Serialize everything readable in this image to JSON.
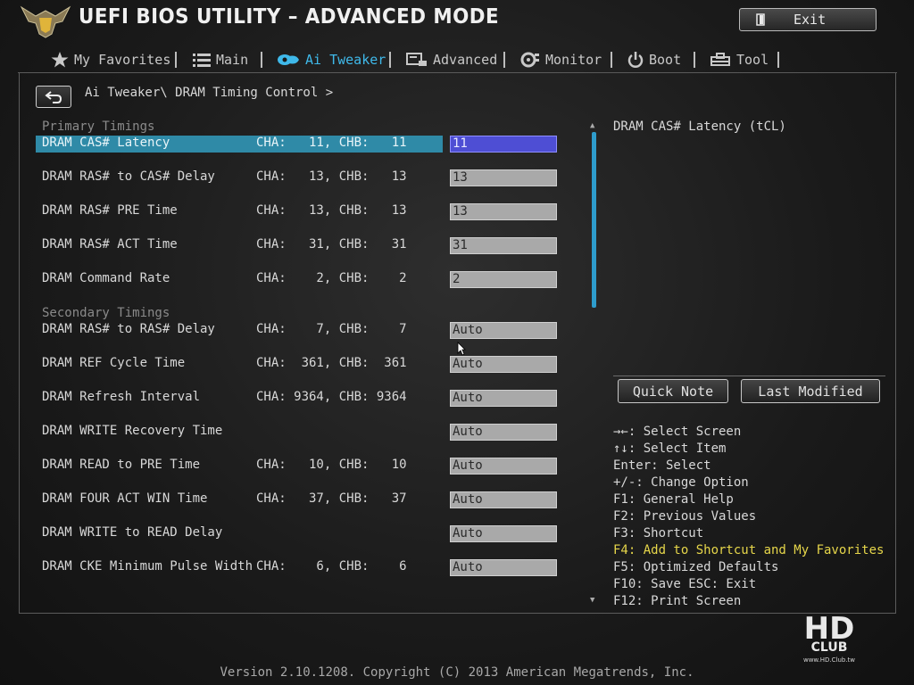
{
  "header": {
    "title": "UEFI BIOS UTILITY – ADVANCED MODE",
    "exit_label": "Exit"
  },
  "tabs": [
    {
      "label": "My Favorites",
      "icon": "star-icon"
    },
    {
      "label": "Main",
      "icon": "list-icon"
    },
    {
      "label": "Ai Tweaker",
      "icon": "tweaker-icon",
      "active": true
    },
    {
      "label": "Advanced",
      "icon": "advanced-icon"
    },
    {
      "label": "Monitor",
      "icon": "monitor-icon"
    },
    {
      "label": "Boot",
      "icon": "power-icon"
    },
    {
      "label": "Tool",
      "icon": "tool-icon"
    }
  ],
  "breadcrumb": "Ai Tweaker\\ DRAM Timing Control >",
  "sections": {
    "primary": "Primary Timings",
    "secondary": "Secondary Timings"
  },
  "rows": [
    {
      "name": "DRAM CAS# Latency",
      "channels": "CHA:   11, CHB:   11",
      "value": "11",
      "selected": true
    },
    {
      "name": "DRAM RAS# to CAS# Delay",
      "channels": "CHA:   13, CHB:   13",
      "value": "13"
    },
    {
      "name": "DRAM RAS# PRE Time",
      "channels": "CHA:   13, CHB:   13",
      "value": "13"
    },
    {
      "name": "DRAM RAS# ACT Time",
      "channels": "CHA:   31, CHB:   31",
      "value": "31"
    },
    {
      "name": "DRAM Command Rate",
      "channels": "CHA:    2, CHB:    2",
      "value": "2"
    },
    {
      "name": "DRAM RAS# to RAS# Delay",
      "channels": "CHA:    7, CHB:    7",
      "value": "Auto"
    },
    {
      "name": "DRAM REF Cycle Time",
      "channels": "CHA:  361, CHB:  361",
      "value": "Auto"
    },
    {
      "name": "DRAM Refresh Interval",
      "channels": "CHA: 9364, CHB: 9364",
      "value": "Auto"
    },
    {
      "name": "DRAM WRITE Recovery Time",
      "channels": "",
      "value": "Auto"
    },
    {
      "name": "DRAM READ to PRE Time",
      "channels": "CHA:   10, CHB:   10",
      "value": "Auto"
    },
    {
      "name": "DRAM FOUR ACT WIN Time",
      "channels": "CHA:   37, CHB:   37",
      "value": "Auto"
    },
    {
      "name": "DRAM WRITE to READ Delay",
      "channels": "",
      "value": "Auto"
    },
    {
      "name": "DRAM CKE Minimum Pulse Width",
      "channels": "CHA:    6, CHB:    6",
      "value": "Auto"
    }
  ],
  "help": {
    "title": "DRAM CAS# Latency (tCL)",
    "quick_note": "Quick Note",
    "last_modified": "Last Modified"
  },
  "keys": [
    {
      "text": "→←: Select Screen"
    },
    {
      "text": "↑↓: Select Item"
    },
    {
      "text": "Enter: Select"
    },
    {
      "text": "+/-: Change Option"
    },
    {
      "text": "F1: General Help"
    },
    {
      "text": "F2: Previous Values"
    },
    {
      "text": "F3: Shortcut"
    },
    {
      "text": "F4: Add to Shortcut and My Favorites",
      "highlight": true
    },
    {
      "text": "F5: Optimized Defaults"
    },
    {
      "text": "F10: Save  ESC: Exit"
    },
    {
      "text": "F12: Print Screen"
    }
  ],
  "footer": {
    "version": "Version 2.10.1208. Copyright (C) 2013 American Megatrends, Inc."
  },
  "watermark": {
    "line1": "HD",
    "line2": "CLUB",
    "url": "www.HD.Club.tw"
  },
  "colors": {
    "accent": "#3fb9ea",
    "selected_row": "#2f8aa7",
    "selected_value": "#4e4ed4",
    "highlight_key": "#e6d64a"
  }
}
